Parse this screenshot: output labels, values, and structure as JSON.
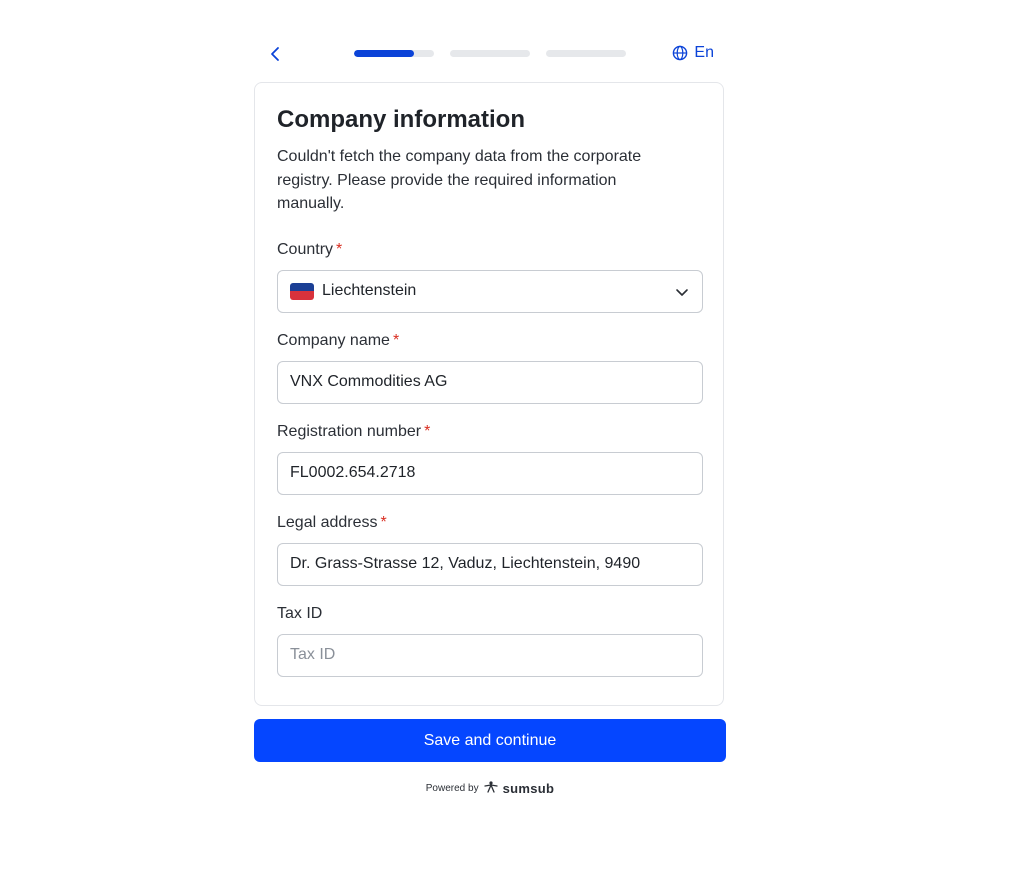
{
  "header": {
    "back_icon": "chevron-left-icon",
    "progress": [
      0.75,
      0,
      0
    ],
    "language": "En",
    "language_icon": "globe-icon"
  },
  "form": {
    "title": "Company information",
    "subtitle": "Couldn't fetch the company data from the corporate registry. Please provide the required information manually.",
    "country": {
      "label": "Country",
      "required_mark": "*",
      "value": "Liechtenstein",
      "flag_colors": [
        "#1b3f95",
        "#d8323c"
      ]
    },
    "company_name": {
      "label": "Company name",
      "required_mark": "*",
      "value": "VNX Commodities AG"
    },
    "registration_number": {
      "label": "Registration number",
      "required_mark": "*",
      "value": "FL0002.654.2718"
    },
    "legal_address": {
      "label": "Legal address",
      "required_mark": "*",
      "value": "Dr. Grass-Strasse 12, Vaduz, Liechtenstein, 9490"
    },
    "tax_id": {
      "label": "Tax ID",
      "value": "",
      "placeholder": "Tax ID"
    }
  },
  "footer": {
    "save_label": "Save and continue",
    "powered_by": "Powered by",
    "brand": "sumsub"
  },
  "colors": {
    "accent": "#0546ff",
    "progress_fill": "#0b43d8",
    "required": "#d92d20"
  }
}
